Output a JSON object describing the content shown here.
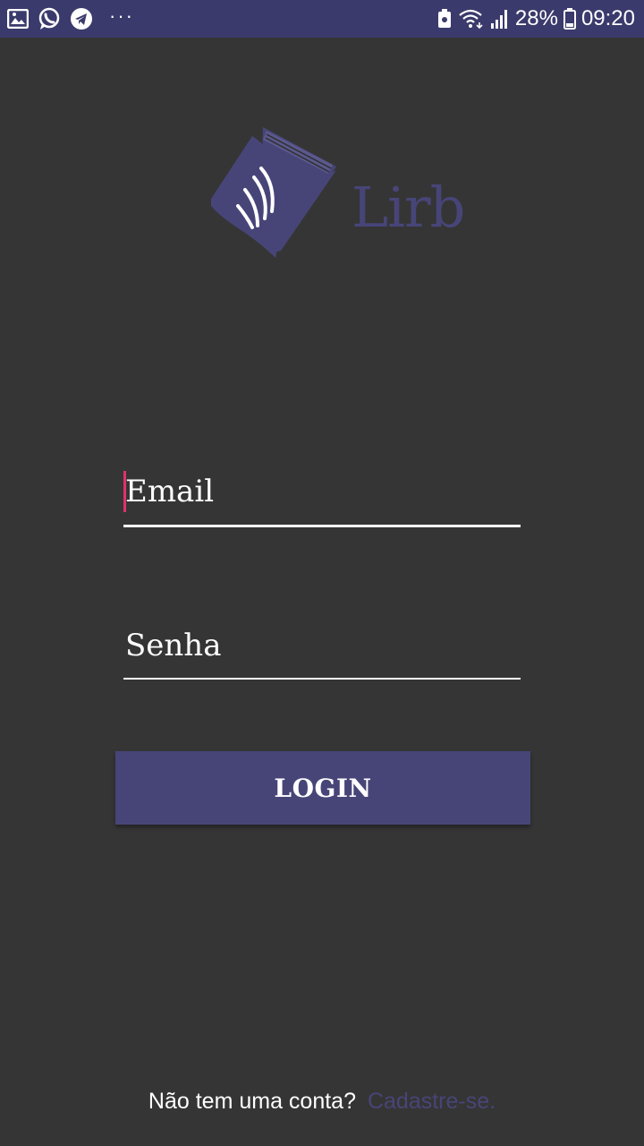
{
  "status_bar": {
    "icons_left": [
      "gallery-icon",
      "whatsapp-icon",
      "telegram-icon"
    ],
    "more": "···",
    "battery_percent": "28%",
    "time": "09:20"
  },
  "brand": {
    "name": "Lirb",
    "color": "#474578"
  },
  "form": {
    "email_placeholder": "Email",
    "senha_placeholder": "Senha",
    "login_label": "LOGIN"
  },
  "footer": {
    "question": "Não tem uma conta?",
    "signup_link": "Cadastre-se."
  },
  "colors": {
    "background": "#353535",
    "status_bar": "#3b3a6c",
    "accent": "#474578",
    "cursor": "#e0316f"
  }
}
